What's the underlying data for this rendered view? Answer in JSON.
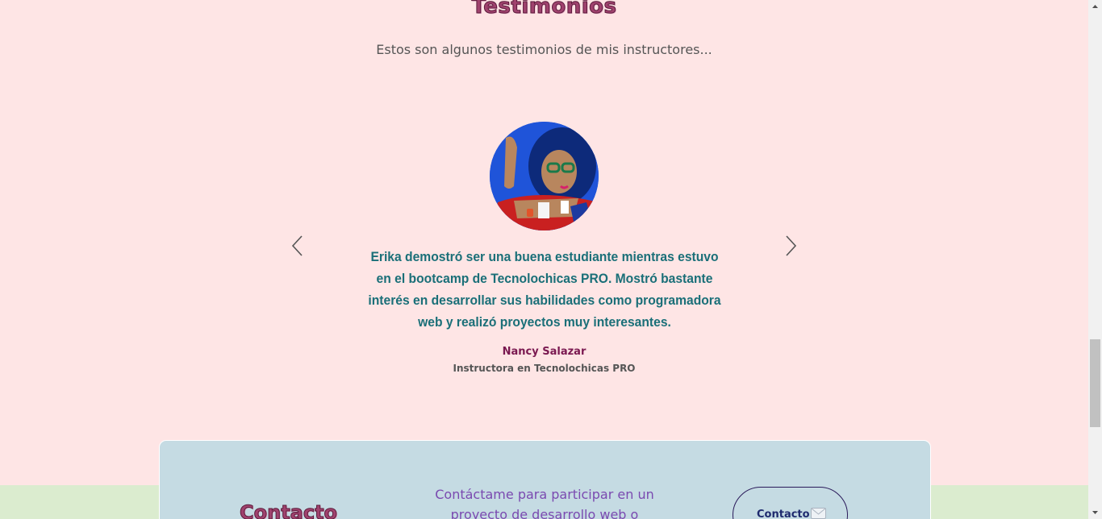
{
  "testimonials": {
    "title": "Testimonios",
    "subtitle": "Estos son algunos testimonios de mis instructores...",
    "prev_icon": "chevron-left-icon",
    "next_icon": "chevron-right-icon",
    "current": {
      "quote": "Erika demostró ser una buena estudiante mientras estuvo en el bootcamp de Tecnolochicas PRO. Mostró bastante interés en desarrollar sus habilidades como programadora web y realizó proyectos muy interesantes.",
      "author": "Nancy Salazar",
      "role": "Instructora en Tecnolochicas PRO"
    }
  },
  "contact": {
    "title": "Contacto",
    "text": "Contáctame para participar en un proyecto de desarrollo web o",
    "button_label": "Contacto",
    "button_icon": "mail-icon"
  },
  "colors": {
    "page_background": "#fee5e5",
    "quote_text": "#1a6f78",
    "author_text": "#7a1850",
    "contact_card": "#c5dbe3",
    "contact_text": "#7a4ab0",
    "band_green": "#dbeccf"
  }
}
